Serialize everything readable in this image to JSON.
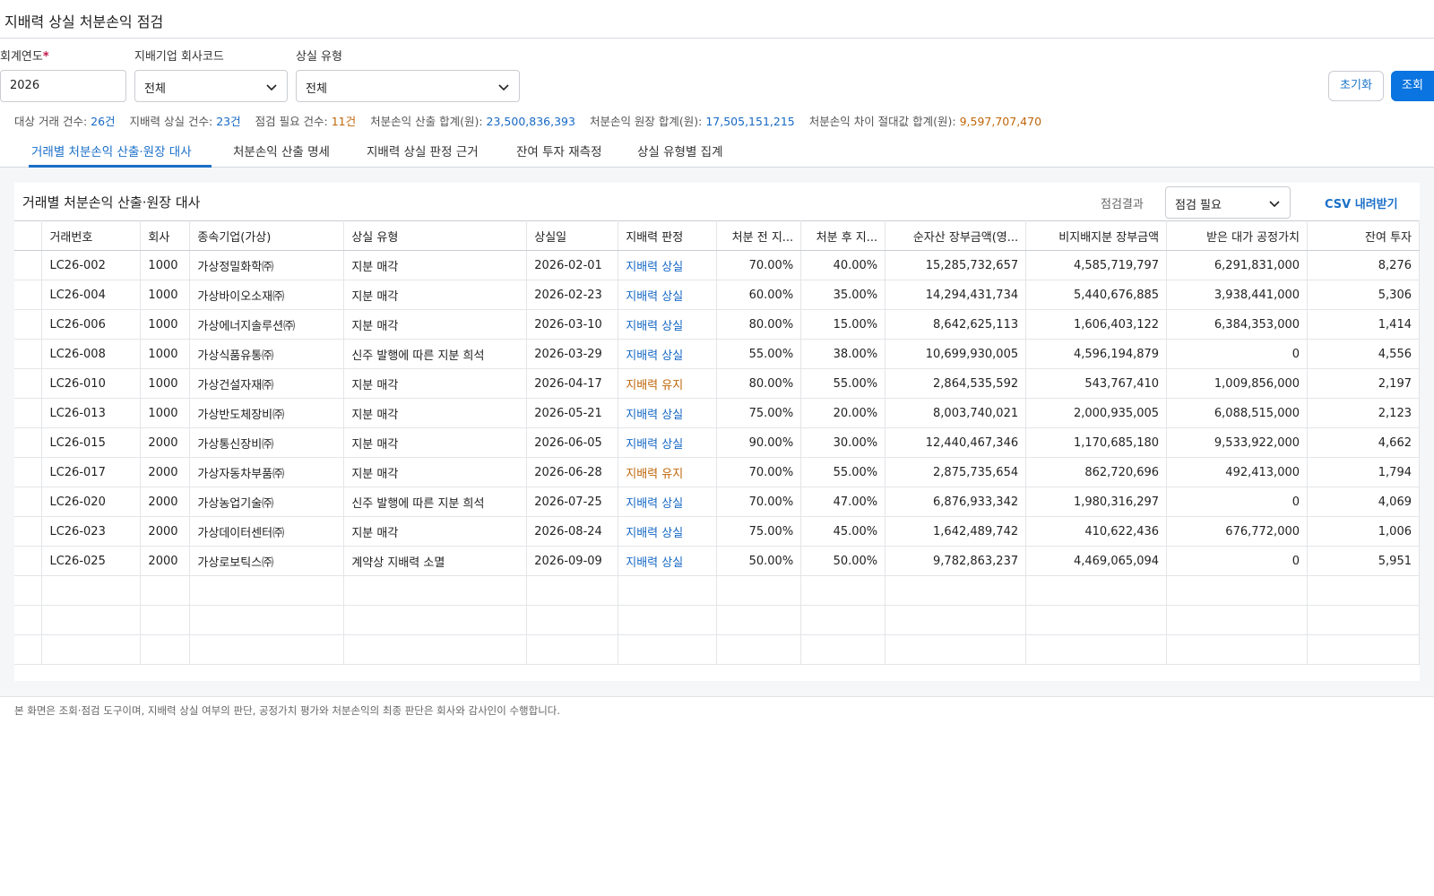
{
  "header": {
    "title": "지배력 상실 처분손익 점검"
  },
  "filters": {
    "fiscal_year": {
      "label": "회계연도",
      "required_mark": "*",
      "value": "2026"
    },
    "company_code": {
      "label": "지배기업 회사코드",
      "value": "전체"
    },
    "loss_type": {
      "label": "상실 유형",
      "value": "전체"
    },
    "reset_label": "초기화",
    "search_label": "조회"
  },
  "summary": [
    {
      "label": "대상 거래 건수: ",
      "value": "26건",
      "tone": "blue"
    },
    {
      "label": "지배력 상실 건수: ",
      "value": "23건",
      "tone": "blue"
    },
    {
      "label": "점검 필요 건수: ",
      "value": "11건",
      "tone": "orange"
    },
    {
      "label": "처분손익 산출 합계(원): ",
      "value": "23,500,836,393",
      "tone": "blue"
    },
    {
      "label": "처분손익 원장 합계(원): ",
      "value": "17,505,151,215",
      "tone": "blue"
    },
    {
      "label": "처분손익 차이 절대값 합계(원): ",
      "value": "9,597,707,470",
      "tone": "orange"
    }
  ],
  "tabs": [
    "거래별 처분손익 산출·원장 대사",
    "처분손익 산출 명세",
    "지배력 상실 판정 근거",
    "잔여 투자 재측정",
    "상실 유형별 집계"
  ],
  "panel": {
    "title": "거래별 처분손익 산출·원장 대사",
    "result_label": "점검결과",
    "result_value": "점검 필요",
    "csv_label": "CSV 내려받기"
  },
  "table": {
    "columns": [
      "",
      "거래번호",
      "회사",
      "종속기업(가상)",
      "상실 유형",
      "상실일",
      "지배력 판정",
      "처분 전 지...",
      "처분 후 지...",
      "순자산 장부금액(영...",
      "비지배지분 장부금액",
      "받은 대가 공정가치",
      "잔여 투자"
    ],
    "rows": [
      [
        "LC26-002",
        "1000",
        "가상정밀화학㈜",
        "지분 매각",
        "2026-02-01",
        "지배력 상실",
        "70.00%",
        "40.00%",
        "15,285,732,657",
        "4,585,719,797",
        "6,291,831,000",
        "8,276"
      ],
      [
        "LC26-004",
        "1000",
        "가상바이오소재㈜",
        "지분 매각",
        "2026-02-23",
        "지배력 상실",
        "60.00%",
        "35.00%",
        "14,294,431,734",
        "5,440,676,885",
        "3,938,441,000",
        "5,306"
      ],
      [
        "LC26-006",
        "1000",
        "가상에너지솔루션㈜",
        "지분 매각",
        "2026-03-10",
        "지배력 상실",
        "80.00%",
        "15.00%",
        "8,642,625,113",
        "1,606,403,122",
        "6,384,353,000",
        "1,414"
      ],
      [
        "LC26-008",
        "1000",
        "가상식품유통㈜",
        "신주 발행에 따른 지분 희석",
        "2026-03-29",
        "지배력 상실",
        "55.00%",
        "38.00%",
        "10,699,930,005",
        "4,596,194,879",
        "0",
        "4,556"
      ],
      [
        "LC26-010",
        "1000",
        "가상건설자재㈜",
        "지분 매각",
        "2026-04-17",
        "지배력 유지",
        "80.00%",
        "55.00%",
        "2,864,535,592",
        "543,767,410",
        "1,009,856,000",
        "2,197"
      ],
      [
        "LC26-013",
        "1000",
        "가상반도체장비㈜",
        "지분 매각",
        "2026-05-21",
        "지배력 상실",
        "75.00%",
        "20.00%",
        "8,003,740,021",
        "2,000,935,005",
        "6,088,515,000",
        "2,123"
      ],
      [
        "LC26-015",
        "2000",
        "가상통신장비㈜",
        "지분 매각",
        "2026-06-05",
        "지배력 상실",
        "90.00%",
        "30.00%",
        "12,440,467,346",
        "1,170,685,180",
        "9,533,922,000",
        "4,662"
      ],
      [
        "LC26-017",
        "2000",
        "가상자동차부품㈜",
        "지분 매각",
        "2026-06-28",
        "지배력 유지",
        "70.00%",
        "55.00%",
        "2,875,735,654",
        "862,720,696",
        "492,413,000",
        "1,794"
      ],
      [
        "LC26-020",
        "2000",
        "가상농업기술㈜",
        "신주 발행에 따른 지분 희석",
        "2026-07-25",
        "지배력 상실",
        "70.00%",
        "47.00%",
        "6,876,933,342",
        "1,980,316,297",
        "0",
        "4,069"
      ],
      [
        "LC26-023",
        "2000",
        "가상데이터센터㈜",
        "지분 매각",
        "2026-08-24",
        "지배력 상실",
        "75.00%",
        "45.00%",
        "1,642,489,742",
        "410,622,436",
        "676,772,000",
        "1,006"
      ],
      [
        "LC26-025",
        "2000",
        "가상로보틱스㈜",
        "계약상 지배력 소멸",
        "2026-09-09",
        "지배력 상실",
        "50.00%",
        "50.00%",
        "9,782,863,237",
        "4,469,065,094",
        "0",
        "5,951"
      ]
    ],
    "empty_rows": 3
  },
  "footnote": "본 화면은 조회·점검 도구이며, 지배력 상실 여부의 판단, 공정가치 평가와 처분손익의 최종 판단은 회사와 감사인이 수행합니다.",
  "colors": {
    "accent": "#0a74e0",
    "link": "#1a6fc8",
    "positive": "#1668c4",
    "warning": "#c0660a"
  },
  "icons": {
    "dropdown": "chevron-down-icon"
  }
}
